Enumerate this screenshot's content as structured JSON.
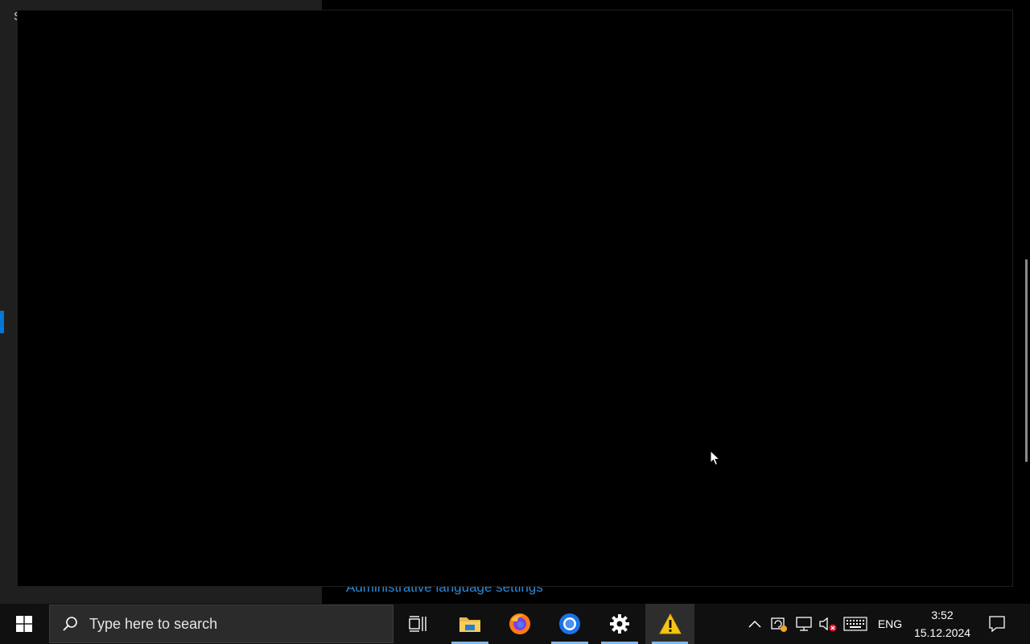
{
  "background_window": {
    "link_text": "Administrative language settings",
    "sidebar_partial_glyphs": [
      "S",
      "",
      "·"
    ]
  },
  "taskbar": {
    "search_placeholder": "Type here to search",
    "pinned_apps": [
      {
        "name": "File Explorer",
        "icon": "folder-icon",
        "running": true
      },
      {
        "name": "Firefox",
        "icon": "firefox-icon",
        "running": false
      },
      {
        "name": "Chrome",
        "icon": "chrome-icon",
        "running": true
      },
      {
        "name": "Settings",
        "icon": "gear-icon",
        "running": true
      },
      {
        "name": "Warning app",
        "icon": "warning-icon",
        "running": true,
        "active": true
      }
    ],
    "tray": {
      "language": "ENG",
      "time": "3:52",
      "date": "15.12.2024"
    }
  },
  "colors": {
    "accent": "#0078d7",
    "link": "#2b88d8",
    "taskbar_bg": "#101010",
    "running_indicator": "#7fb7ea"
  }
}
